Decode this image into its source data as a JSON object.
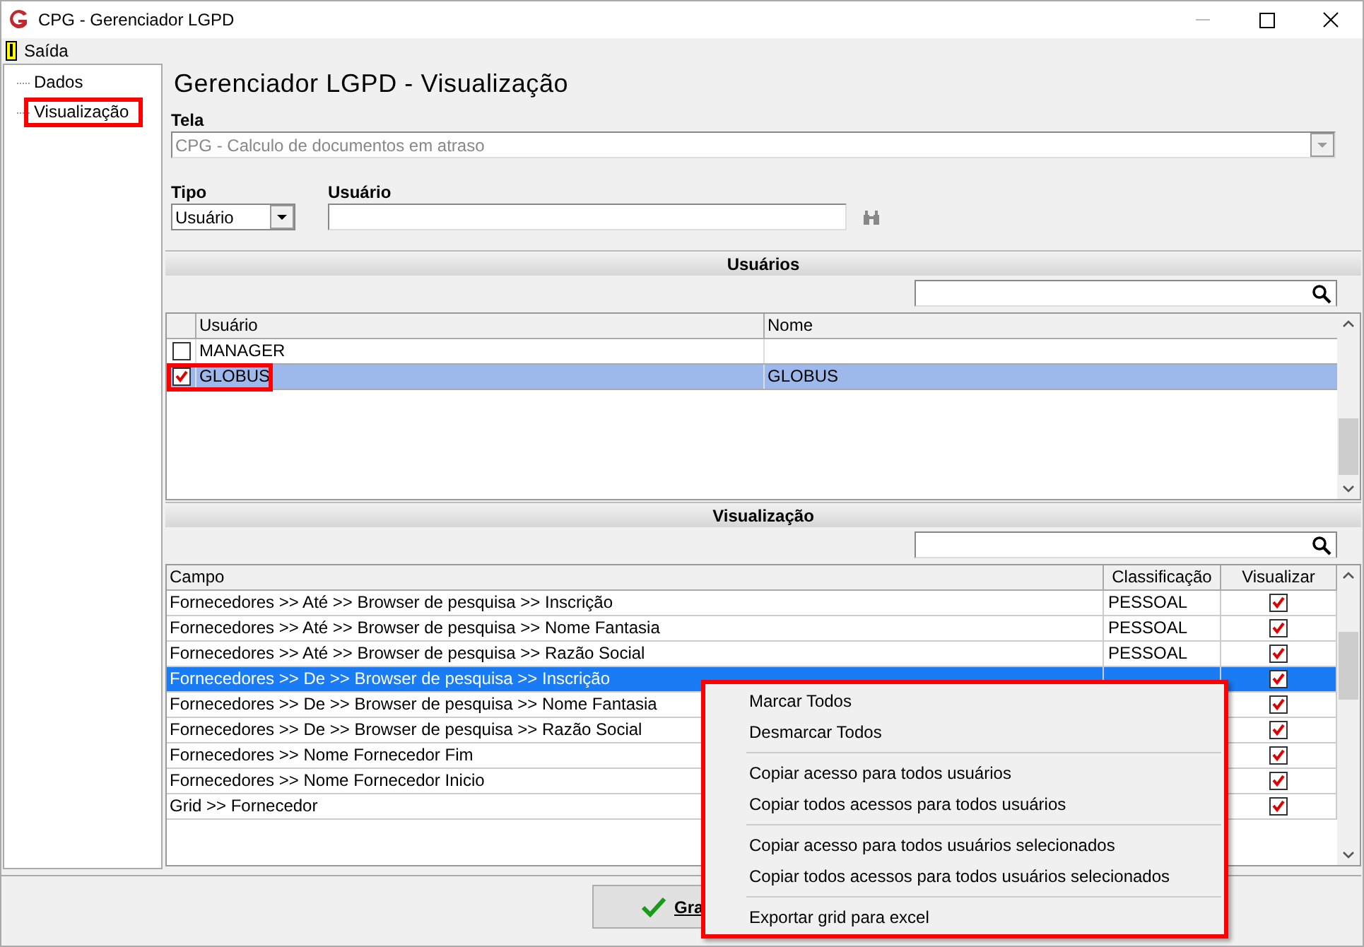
{
  "window": {
    "title": "CPG - Gerenciador LGPD"
  },
  "menu": [
    {
      "label": "Saída"
    }
  ],
  "tree": [
    {
      "label": "Dados",
      "highlighted": false
    },
    {
      "label": "Visualização",
      "highlighted": true
    }
  ],
  "heading": "Gerenciador LGPD - Visualização",
  "tela": {
    "label": "Tela",
    "value": "CPG - Calculo de documentos em atraso",
    "disabled": true
  },
  "tipo": {
    "label": "Tipo",
    "value": "Usuário"
  },
  "usuario": {
    "label": "Usuário"
  },
  "usuarios": {
    "title": "Usuários",
    "columns": [
      "Usuário",
      "Nome"
    ],
    "rows": [
      {
        "usuario": "MANAGER",
        "checked": false,
        "selected": false,
        "highlighted": false
      },
      {
        "usuario": "GLOBUS",
        "nome": "GLOBUS",
        "checked": true,
        "selected": true,
        "highlighted": true
      }
    ]
  },
  "visualizacao": {
    "title": "Visualização",
    "columns": [
      "Campo",
      "Classificação",
      "Visualizar"
    ],
    "rows": [
      {
        "campo": "Fornecedores >> Até >> Browser de pesquisa >> Inscrição",
        "classificacao": "PESSOAL",
        "visualizar": true,
        "selected": false
      },
      {
        "campo": "Fornecedores >> Até >> Browser de pesquisa >> Nome Fantasia",
        "classificacao": "PESSOAL",
        "visualizar": true,
        "selected": false
      },
      {
        "campo": "Fornecedores >> Até >> Browser de pesquisa >> Razão Social",
        "classificacao": "PESSOAL",
        "visualizar": true,
        "selected": false
      },
      {
        "campo": "Fornecedores >> De >> Browser de pesquisa >> Inscrição",
        "visualizar": true,
        "selected": true
      },
      {
        "campo": "Fornecedores >> De >> Browser de pesquisa >> Nome Fantasia",
        "visualizar": true,
        "selected": false
      },
      {
        "campo": "Fornecedores >> De >> Browser de pesquisa >> Razão Social",
        "visualizar": true,
        "selected": false
      },
      {
        "campo": "Fornecedores >> Nome Fornecedor Fim",
        "visualizar": true,
        "selected": false
      },
      {
        "campo": "Fornecedores >> Nome Fornecedor Inicio",
        "visualizar": true,
        "selected": false
      },
      {
        "campo": "Grid >> Fornecedor",
        "visualizar": true,
        "selected": false
      }
    ]
  },
  "save_button": {
    "label": "Gra"
  },
  "context_menu": {
    "highlighted": true,
    "groups": [
      [
        "Marcar Todos",
        "Desmarcar Todos"
      ],
      [
        "Copiar acesso para todos usuários",
        "Copiar todos acessos para todos usuários"
      ],
      [
        "Copiar acesso para todos usuários selecionados",
        "Copiar todos acessos para todos usuários selecionados"
      ],
      [
        "Exportar grid para excel"
      ]
    ]
  }
}
